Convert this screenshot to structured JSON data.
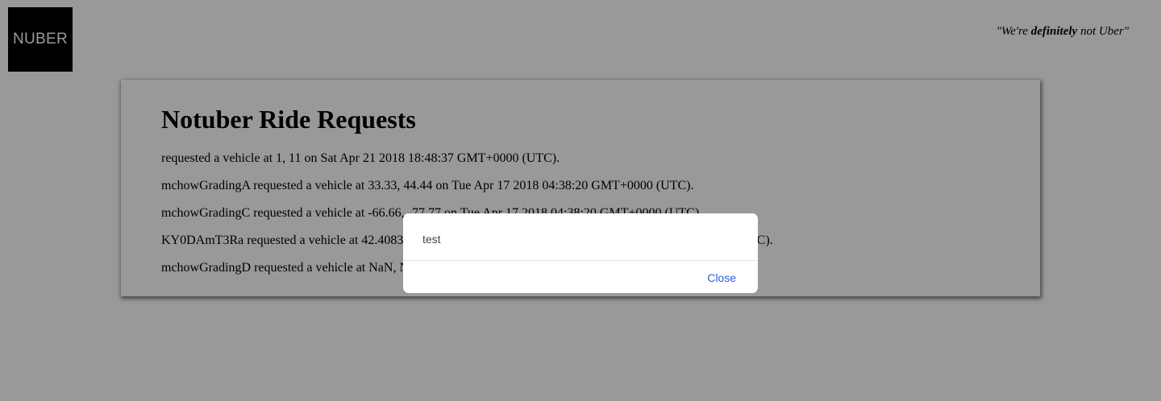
{
  "header": {
    "logo_text": "NUBER",
    "tagline_open": "\"We're ",
    "tagline_bold": "definitely",
    "tagline_close": " not Uber\""
  },
  "main": {
    "title": "Notuber Ride Requests",
    "requests": [
      " requested a vehicle at 1, 11 on Sat Apr 21 2018 18:48:37 GMT+0000 (UTC).",
      "mchowGradingA requested a vehicle at 33.33, 44.44 on Tue Apr 17 2018 04:38:20 GMT+0000 (UTC).",
      "mchowGradingC requested a vehicle at -66.66, -77.77 on Tue Apr 17 2018 04:38:20 GMT+0000 (UTC).",
      "KY0DAmT3Ra requested a vehicle at 42.4083",
      "mchowGradingD requested a vehicle at NaN, N"
    ],
    "request_4_tail": "0 (UTC)."
  },
  "dialog": {
    "message": "test",
    "close_label": "Close"
  },
  "colors": {
    "overlay": "#000000",
    "link": "#2b5cd6"
  }
}
